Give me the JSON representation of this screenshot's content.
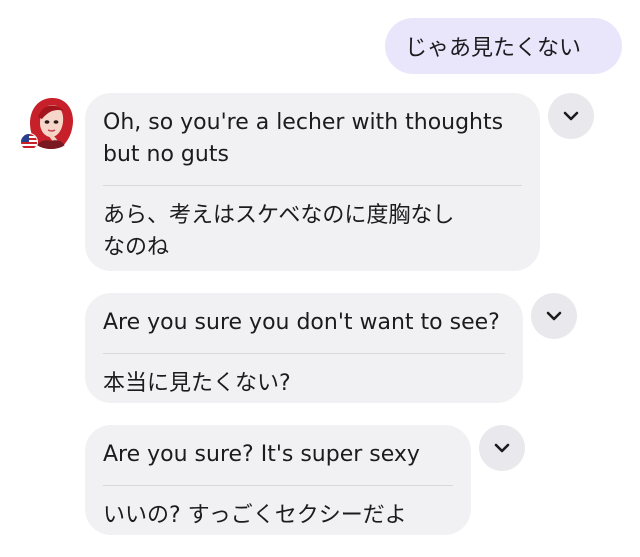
{
  "user_message": {
    "text": "じゃあ見たくない"
  },
  "bot_messages": [
    {
      "english": "Oh, so you're a lecher with thoughts\nbut no guts",
      "japanese": "あら、考えはスケベなのに度胸なし\nなのね",
      "expand_icon": "chevron-down-icon"
    },
    {
      "english": "Are you sure you don't want to see?",
      "japanese": "本当に見たくない?",
      "expand_icon": "chevron-down-icon"
    },
    {
      "english": "Are you sure? It's super sexy",
      "japanese": "いいの? すっごくセクシーだよ",
      "expand_icon": "chevron-down-icon"
    }
  ],
  "colors": {
    "user_bubble": "#e9e6fb",
    "bot_bubble": "#f1f1f4",
    "chevron_button": "#e9e9ed",
    "avatar_hair": "#c8202a"
  },
  "avatar": {
    "icon": "avatar-icon",
    "flag_icon": "us-flag-icon"
  }
}
